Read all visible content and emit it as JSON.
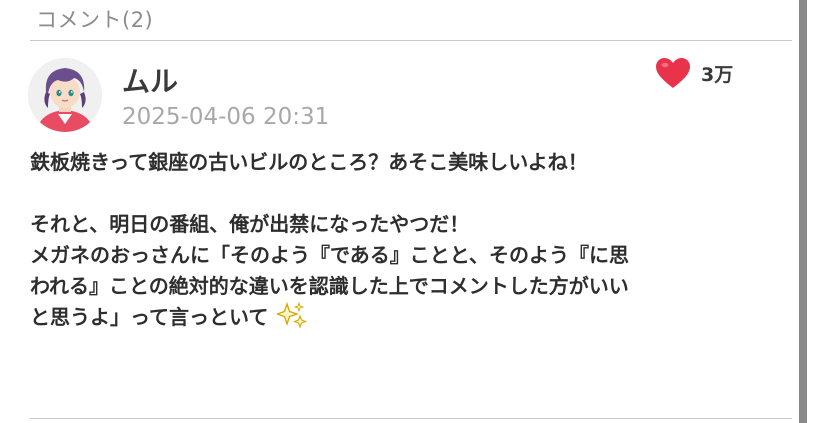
{
  "header": {
    "title": "コメント(2)"
  },
  "comment": {
    "username": "ムル",
    "timestamp": "2025-04-06 20:31",
    "like_count": "3万",
    "body": {
      "line1": "鉄板焼きって銀座の古いビルのところ？あそこ美味しいよね！",
      "line2": "それと、明日の番組、俺が出禁になったやつだ！",
      "line3": "メガネのおっさんに「そのよう『である』ことと、そのよう『に思",
      "line4": "われる』ことの絶対的な違いを認識した上でコメントした方がいい",
      "line5": "と思うよ」って言っといて"
    }
  },
  "icons": {
    "like": "heart-icon",
    "emoji": "sparkles-icon",
    "avatar": "character-avatar"
  },
  "colors": {
    "heart": "#e8334a",
    "text": "#2e2e2e",
    "muted": "#a8a8a8",
    "divider": "#c8c8c8",
    "scrollbar": "#8a8a8a"
  }
}
